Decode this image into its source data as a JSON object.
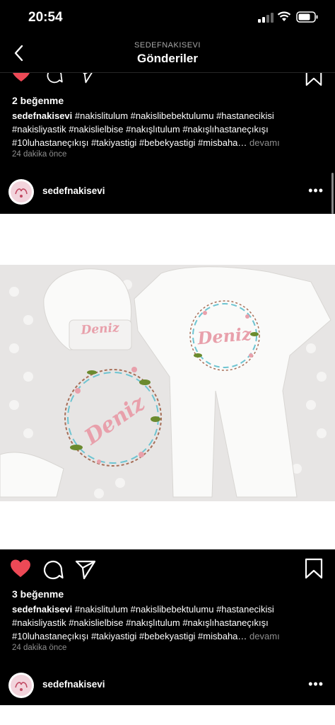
{
  "status_bar": {
    "time": "20:54"
  },
  "nav": {
    "subtitle": "SEDEFNAKISEVI",
    "title": "Gönderiler"
  },
  "posts": [
    {
      "likes": "2 beğenme",
      "username": "sedefnakisevi",
      "caption": "#nakislitulum #nakislibebektulumu #hastanecikisi #nakisliyastik #nakislielbise #nakışlıtulum #nakışlıhastaneçıkışı #10luhastaneçıkışı #takiyastigi #bebekyastigi #misbaha…",
      "more": "devamı",
      "time_ago": "24 dakika önce"
    },
    {
      "username": "sedefnakisevi",
      "image": {
        "embroidery_text": "Deniz"
      },
      "likes": "3 beğenme",
      "caption": "#nakislitulum #nakislibebektulumu #hastanecikisi #nakisliyastik #nakislielbise #nakışlıtulum #nakışlıhastaneçıkışı #10luhastaneçıkışı #takiyastigi #bebekyastigi #misbaha…",
      "more": "devamı",
      "time_ago": "24 dakika önce"
    },
    {
      "username": "sedefnakisevi"
    }
  ],
  "colors": {
    "like_red": "#ed4956",
    "secondary_text": "#8e8e8e",
    "embroidery_pink": "#e8a0ab"
  },
  "icons": [
    "back-chevron-icon",
    "heart-icon",
    "comment-icon",
    "share-icon",
    "bookmark-icon",
    "more-icon"
  ]
}
